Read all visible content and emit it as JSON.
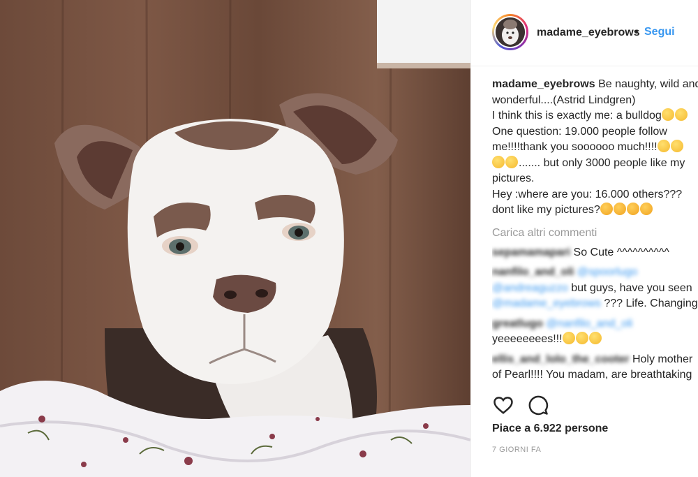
{
  "photo": {
    "subject": "",
    "colors": {
      "wood": "#6d4a3a",
      "fur": "#f4f2f0",
      "patch": "#7a5a4d"
    }
  },
  "header": {
    "username": "madame_eyebrows",
    "separator": "•",
    "follow_label": "Segui"
  },
  "caption": {
    "username": "madame_eyebrows",
    "lines": [
      "Be naughty, wild and",
      "wonderful....(Astrid Lindgren)",
      "I think this is exactly me: a bulldog",
      "One question: 19.000 people follow",
      "me!!!!thank you soooooo much!!!!",
      "....... but only 3000 people like my",
      "pictures.",
      "Hey :where are you: 16.000 others???",
      "dont like my pictures?"
    ]
  },
  "load_more": "Carica altri commenti",
  "comments": [
    {
      "user_blurred": "sepamamapari",
      "text": "So Cute ^^^^^^^^^^"
    },
    {
      "user_blurred": "nanfilo_and_oli",
      "mention1": "@spoorlugo",
      "mention2": "@andreaguzzo",
      "text": "but guys, have you seen",
      "mention3": "@madame_eyebrows",
      "text2": "??? Life. Changing."
    },
    {
      "user_blurred": "greatlugo",
      "mention1": "@nanfilo_and_oli",
      "text": "yeeeeeeees!!!"
    },
    {
      "user_blurred": "ellis_and_lolo_the_cooter",
      "text": "Holy mother",
      "text2": "of Pearl!!!! You madam, are breathtaking"
    }
  ],
  "likes_text": "Piace a 6.922 persone",
  "time_ago": "7 GIORNI FA",
  "icons": {
    "like": "heart-icon",
    "comment": "comment-icon"
  },
  "accent": "#3897f0"
}
